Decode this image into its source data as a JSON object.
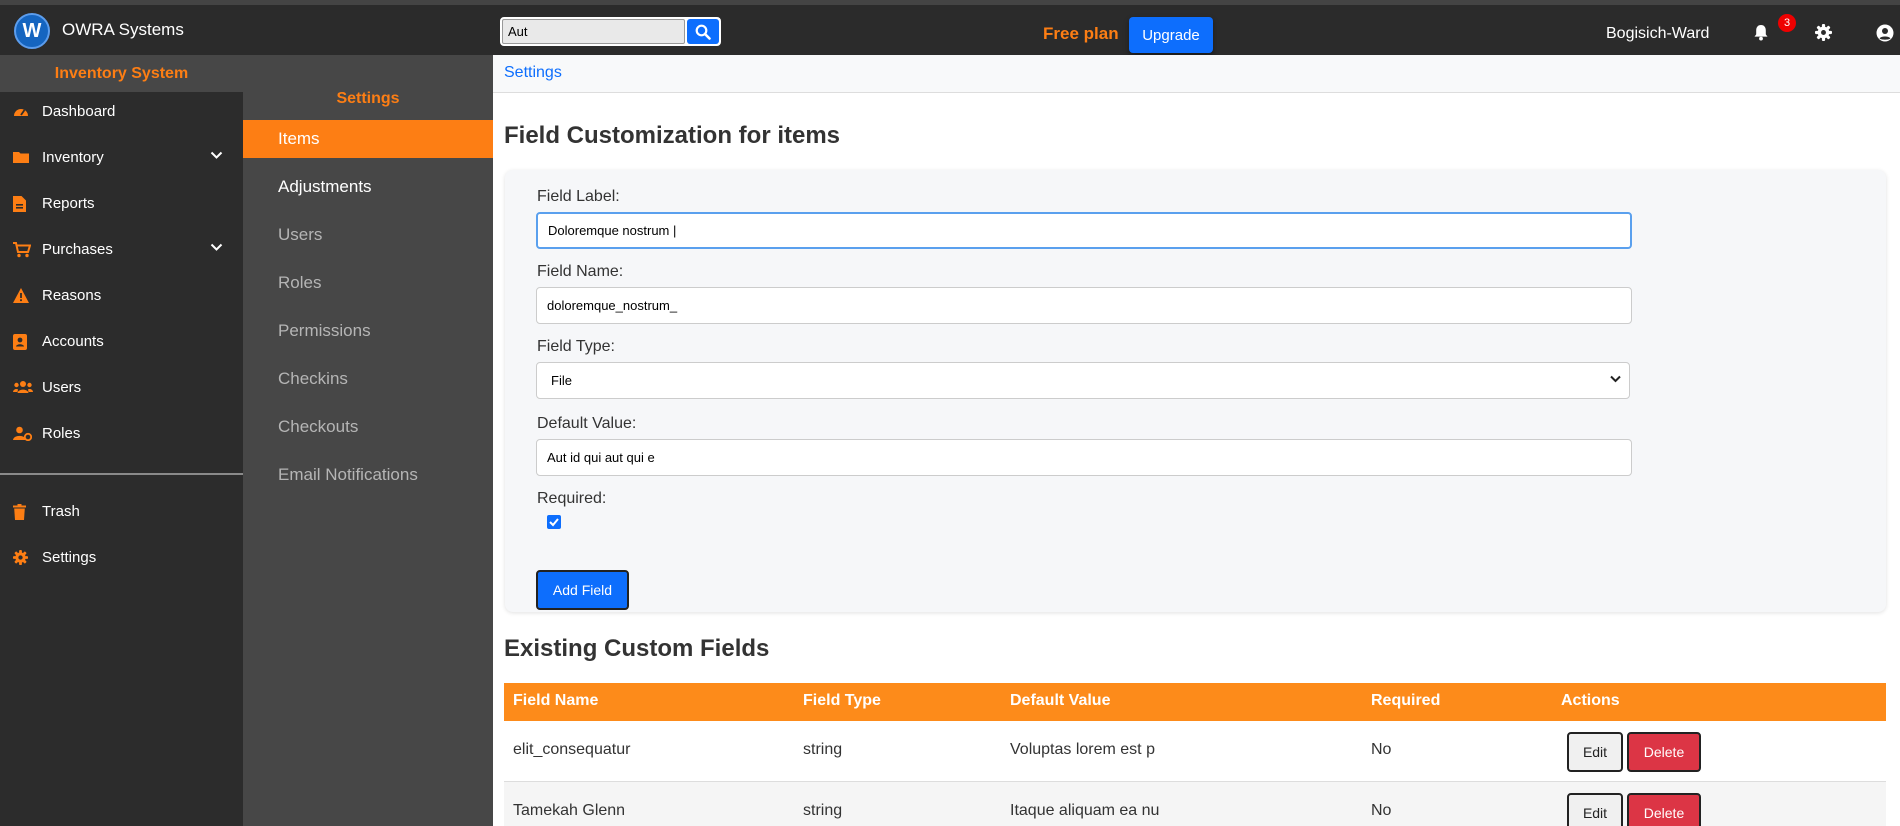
{
  "app": {
    "logo_letter": "W",
    "brand": "OWRA Systems"
  },
  "search": {
    "value": "Aut"
  },
  "header": {
    "free_plan": "Free plan",
    "upgrade": "Upgrade",
    "company": "Bogisich-Ward",
    "notifications_count": "3"
  },
  "sidebar": {
    "title": "Inventory System",
    "items": [
      {
        "label": "Dashboard",
        "icon": "gauge-icon"
      },
      {
        "label": "Inventory",
        "icon": "folder-icon"
      },
      {
        "label": "Reports",
        "icon": "file-icon"
      },
      {
        "label": "Purchases",
        "icon": "cart-icon"
      },
      {
        "label": "Reasons",
        "icon": "warning-icon"
      },
      {
        "label": "Accounts",
        "icon": "address-book-icon"
      },
      {
        "label": "Users",
        "icon": "users-icon"
      },
      {
        "label": "Roles",
        "icon": "user-gear-icon"
      },
      {
        "label": "Trash",
        "icon": "trash-icon"
      },
      {
        "label": "Settings",
        "icon": "gear-icon"
      }
    ]
  },
  "submenu": {
    "title": "Settings",
    "items": [
      "Items",
      "Adjustments",
      "Users",
      "Roles",
      "Permissions",
      "Checkins",
      "Checkouts",
      "Email Notifications"
    ]
  },
  "breadcrumb": "Settings",
  "form": {
    "title": "Field Customization for items",
    "label_label": "Field Label:",
    "label_value": "Doloremque nostrum |",
    "name_label": "Field Name:",
    "name_value": "doloremque_nostrum_",
    "type_label": "Field Type:",
    "type_value": "File",
    "default_label": "Default Value:",
    "default_value": "Aut id qui aut qui e",
    "required_label": "Required:",
    "required_checked": true,
    "add_button": "Add Field"
  },
  "table": {
    "title": "Existing Custom Fields",
    "headers": [
      "Field Name",
      "Field Type",
      "Default Value",
      "Required",
      "Actions"
    ],
    "rows": [
      {
        "name": "elit_consequatur",
        "type": "string",
        "default": "Voluptas lorem est p",
        "required": "No"
      },
      {
        "name": "Tamekah Glenn",
        "type": "string",
        "default": "Itaque aliquam ea nu",
        "required": "No"
      }
    ],
    "edit_label": "Edit",
    "delete_label": "Delete"
  },
  "colors": {
    "accent": "#fd7e14",
    "primary": "#0d6efd",
    "danger": "#dc3545",
    "sidebar": "#2c2c2c",
    "submenu": "#474747"
  }
}
